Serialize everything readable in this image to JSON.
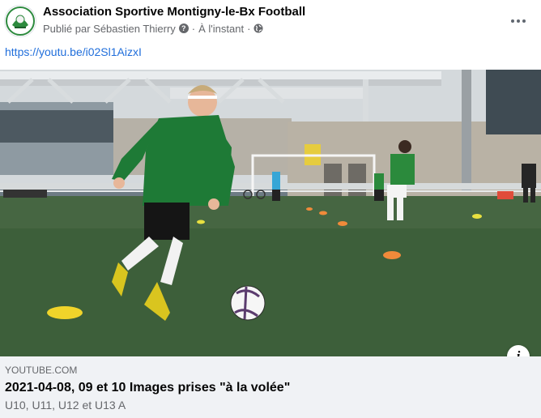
{
  "post": {
    "page_name": "Association Sportive Montigny-le-Bx Football",
    "published_by": "Publié par Sébastien Thierry",
    "info_glyph": "?",
    "separator": "·",
    "time": "À l'instant",
    "audience_icon": "globe-icon",
    "more_icon": "more-options-icon",
    "link_text": "https://youtu.be/i02Sl1AizxI"
  },
  "link_preview": {
    "domain": "YOUTUBE.COM",
    "title": "2021-04-08, 09 et 10 Images prises \"à la volée\"",
    "description": "U10, U11, U12 et U13 A",
    "info_label": "i"
  },
  "colors": {
    "link": "#216fdb",
    "secondary_text": "#65676b",
    "card_background": "#f0f2f5",
    "jersey_green": "#1e7a36",
    "pitch_green": "#3d5f3a"
  }
}
